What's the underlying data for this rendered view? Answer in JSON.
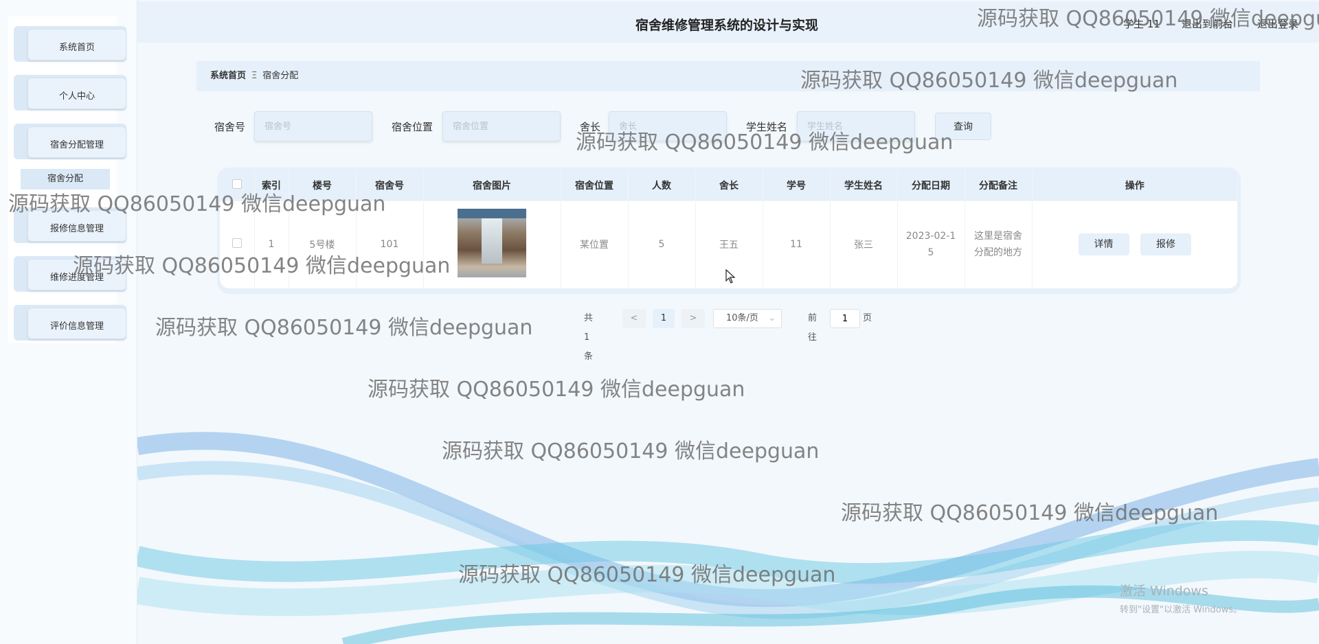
{
  "header": {
    "title": "宿舍维修管理系统的设计与实现",
    "user": "学生 11",
    "link_front": "退出到前台",
    "link_logout": "退出登录"
  },
  "sidebar": {
    "items": [
      {
        "label": "系统首页"
      },
      {
        "label": "个人中心"
      },
      {
        "label": "宿舍分配管理"
      },
      {
        "label": "报修信息管理"
      },
      {
        "label": "维修进度管理"
      },
      {
        "label": "评价信息管理"
      }
    ],
    "sub_item": "宿舍分配"
  },
  "breadcrumb": {
    "home": "系统首页",
    "separator": "Ξ",
    "current": "宿舍分配"
  },
  "search": {
    "fields": [
      {
        "label": "宿舍号",
        "placeholder": "宿舍号"
      },
      {
        "label": "宿舍位置",
        "placeholder": "宿舍位置"
      },
      {
        "label": "舍长",
        "placeholder": "舍长"
      },
      {
        "label": "学生姓名",
        "placeholder": "学生姓名"
      }
    ],
    "button": "查询"
  },
  "table": {
    "columns": [
      "索引",
      "楼号",
      "宿舍号",
      "宿舍图片",
      "宿舍位置",
      "人数",
      "舍长",
      "学号",
      "学生姓名",
      "分配日期",
      "分配备注",
      "操作"
    ],
    "rows": [
      {
        "index": "1",
        "building": "5号楼",
        "room": "101",
        "location": "某位置",
        "count": "5",
        "leader": "王五",
        "student_no": "11",
        "student_name": "张三",
        "date": "2023-02-15",
        "remark": "这里是宿舍分配的地方",
        "btn_detail": "详情",
        "btn_repair": "报修"
      }
    ]
  },
  "pagination": {
    "total": "共 1 条",
    "prev": "<",
    "page": "1",
    "next": ">",
    "page_size": "10条/页",
    "goto_label": "前往",
    "goto_value": "1",
    "goto_suffix": "页"
  },
  "watermark": "源码获取 QQ86050149 微信deepguan",
  "windows_notice": {
    "line1": "激活 Windows",
    "line2": "转到\"设置\"以激活 Windows。"
  }
}
